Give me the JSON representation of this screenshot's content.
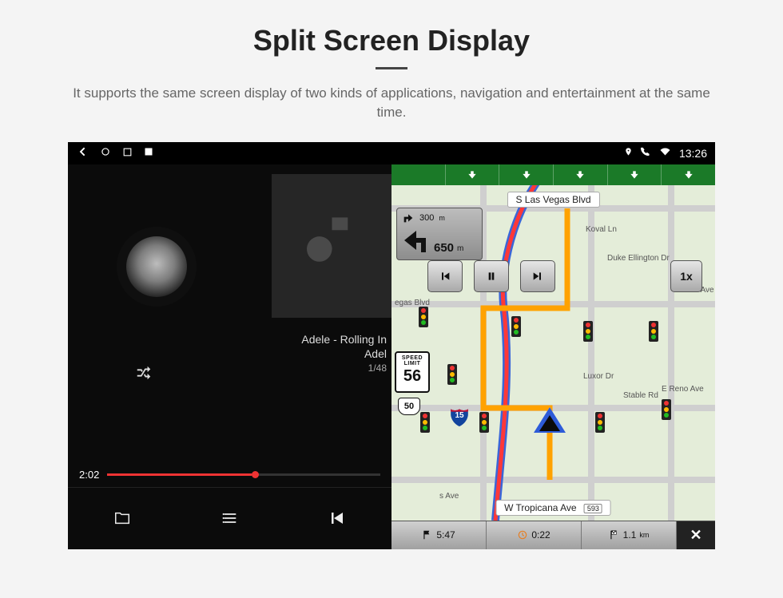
{
  "hero": {
    "title": "Split Screen Display",
    "description": "It supports the same screen display of two kinds of applications, navigation and entertainment at the same time."
  },
  "status": {
    "clock": "13:26"
  },
  "player": {
    "track_line1": "Adele - Rolling In",
    "track_line2": "Adel",
    "track_index": "1/48",
    "elapsed": "2:02"
  },
  "nav": {
    "top_road": "S Las Vegas Blvd",
    "bottom_road": "W Tropicana Ave",
    "bottom_road_num": "593",
    "streets": {
      "koval": "Koval Ln",
      "duke": "Duke Ellington Dr",
      "luxor": "Luxor Dr",
      "stable": "Stable Rd",
      "reno": "E Reno Ave",
      "vegas": "egas Blvd",
      "ides": "ides Ave",
      "sAve": "s Ave"
    },
    "turn": {
      "next_dist": "300",
      "next_unit": "m",
      "main_dist": "650",
      "main_unit": "m"
    },
    "speed_limit_label1": "SPEED",
    "speed_limit_label2": "LIMIT",
    "speed_limit_value": "56",
    "shield_us": "50",
    "shield_interstate": "15",
    "playback_speed": "1x",
    "footer": {
      "eta": "5:47",
      "time_remaining": "0:22",
      "distance": "1.1",
      "distance_unit": "km"
    }
  }
}
